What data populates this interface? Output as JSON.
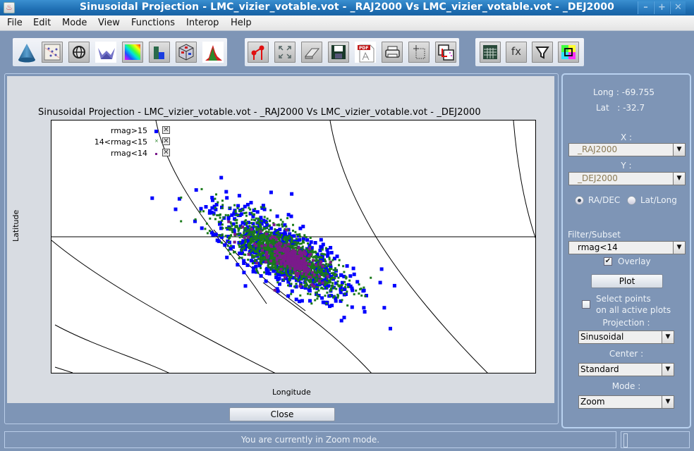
{
  "window": {
    "title": "Sinusoidal Projection - LMC_vizier_votable.vot - _RAJ2000   Vs  LMC_vizier_votable.vot - _DEJ2000",
    "controls": [
      "minimize",
      "maximize",
      "close"
    ]
  },
  "menu": [
    {
      "label": "File",
      "mnemonic": "F"
    },
    {
      "label": "Edit",
      "mnemonic": "E"
    },
    {
      "label": "Mode",
      "mnemonic": "M"
    },
    {
      "label": "View",
      "mnemonic": "V"
    },
    {
      "label": "Functions",
      "mnemonic": "F"
    },
    {
      "label": "Interop",
      "mnemonic": "I"
    },
    {
      "label": "Help",
      "mnemonic": "H"
    }
  ],
  "toolbar": {
    "group1": [
      "3d-cone-icon",
      "scatter-plot-icon",
      "sky-projection-icon",
      "surface-plot-icon",
      "density-map-icon",
      "histogram-icon",
      "cube-3d-icon",
      "multi-histogram-icon"
    ],
    "group2": [
      "overlay-points-icon",
      "zoom-fit-icon",
      "eraser-icon",
      "save-icon",
      "pdf-export-icon",
      "print-icon",
      "select-region-icon",
      "copy-plot-icon"
    ],
    "group3": [
      "table-view-icon",
      "function-icon",
      "filter-icon",
      "color-settings-icon"
    ],
    "group3_labels": {
      "function": "fx"
    }
  },
  "plot": {
    "title": "Sinusoidal Projection - LMC_vizier_votable.vot - _RAJ2000   Vs  LMC_vizier_votable.vot - _DEJ2000",
    "xlabel": "Longitude",
    "ylabel": "Latitude",
    "legend": [
      {
        "label": "rmag>15",
        "color": "#0000ff",
        "marker": "square",
        "checked": true
      },
      {
        "label": "14<rmag<15",
        "color": "#1a7a1a",
        "marker": "cross",
        "checked": true
      },
      {
        "label": "rmag<14",
        "color": "#7a1a8a",
        "marker": "square",
        "checked": true
      }
    ],
    "close_label": "Close"
  },
  "side_panel": {
    "long_label": "Long :",
    "long_value": "-69.755",
    "lat_label": "Lat   :",
    "lat_value": "-32.7",
    "x_label": "X :",
    "x_value": "_RAJ2000",
    "y_label": "Y :",
    "y_value": "_DEJ2000",
    "coord_options": [
      {
        "label": "RA/DEC",
        "selected": true
      },
      {
        "label": "Lat/Long",
        "selected": false
      }
    ],
    "filter_label": "Filter/Subset",
    "filter_value": "rmag<14",
    "overlay_label": "Overlay",
    "overlay_checked": true,
    "plot_label": "Plot",
    "select_points_label_1": "Select points",
    "select_points_label_2": "on all active plots",
    "select_points_checked": false,
    "projection_label": "Projection :",
    "projection_value": "Sinusoidal",
    "center_label": "Center :",
    "center_value": "Standard",
    "mode_label": "Mode :",
    "mode_value": "Zoom"
  },
  "status": {
    "message": "You are currently in Zoom mode."
  }
}
